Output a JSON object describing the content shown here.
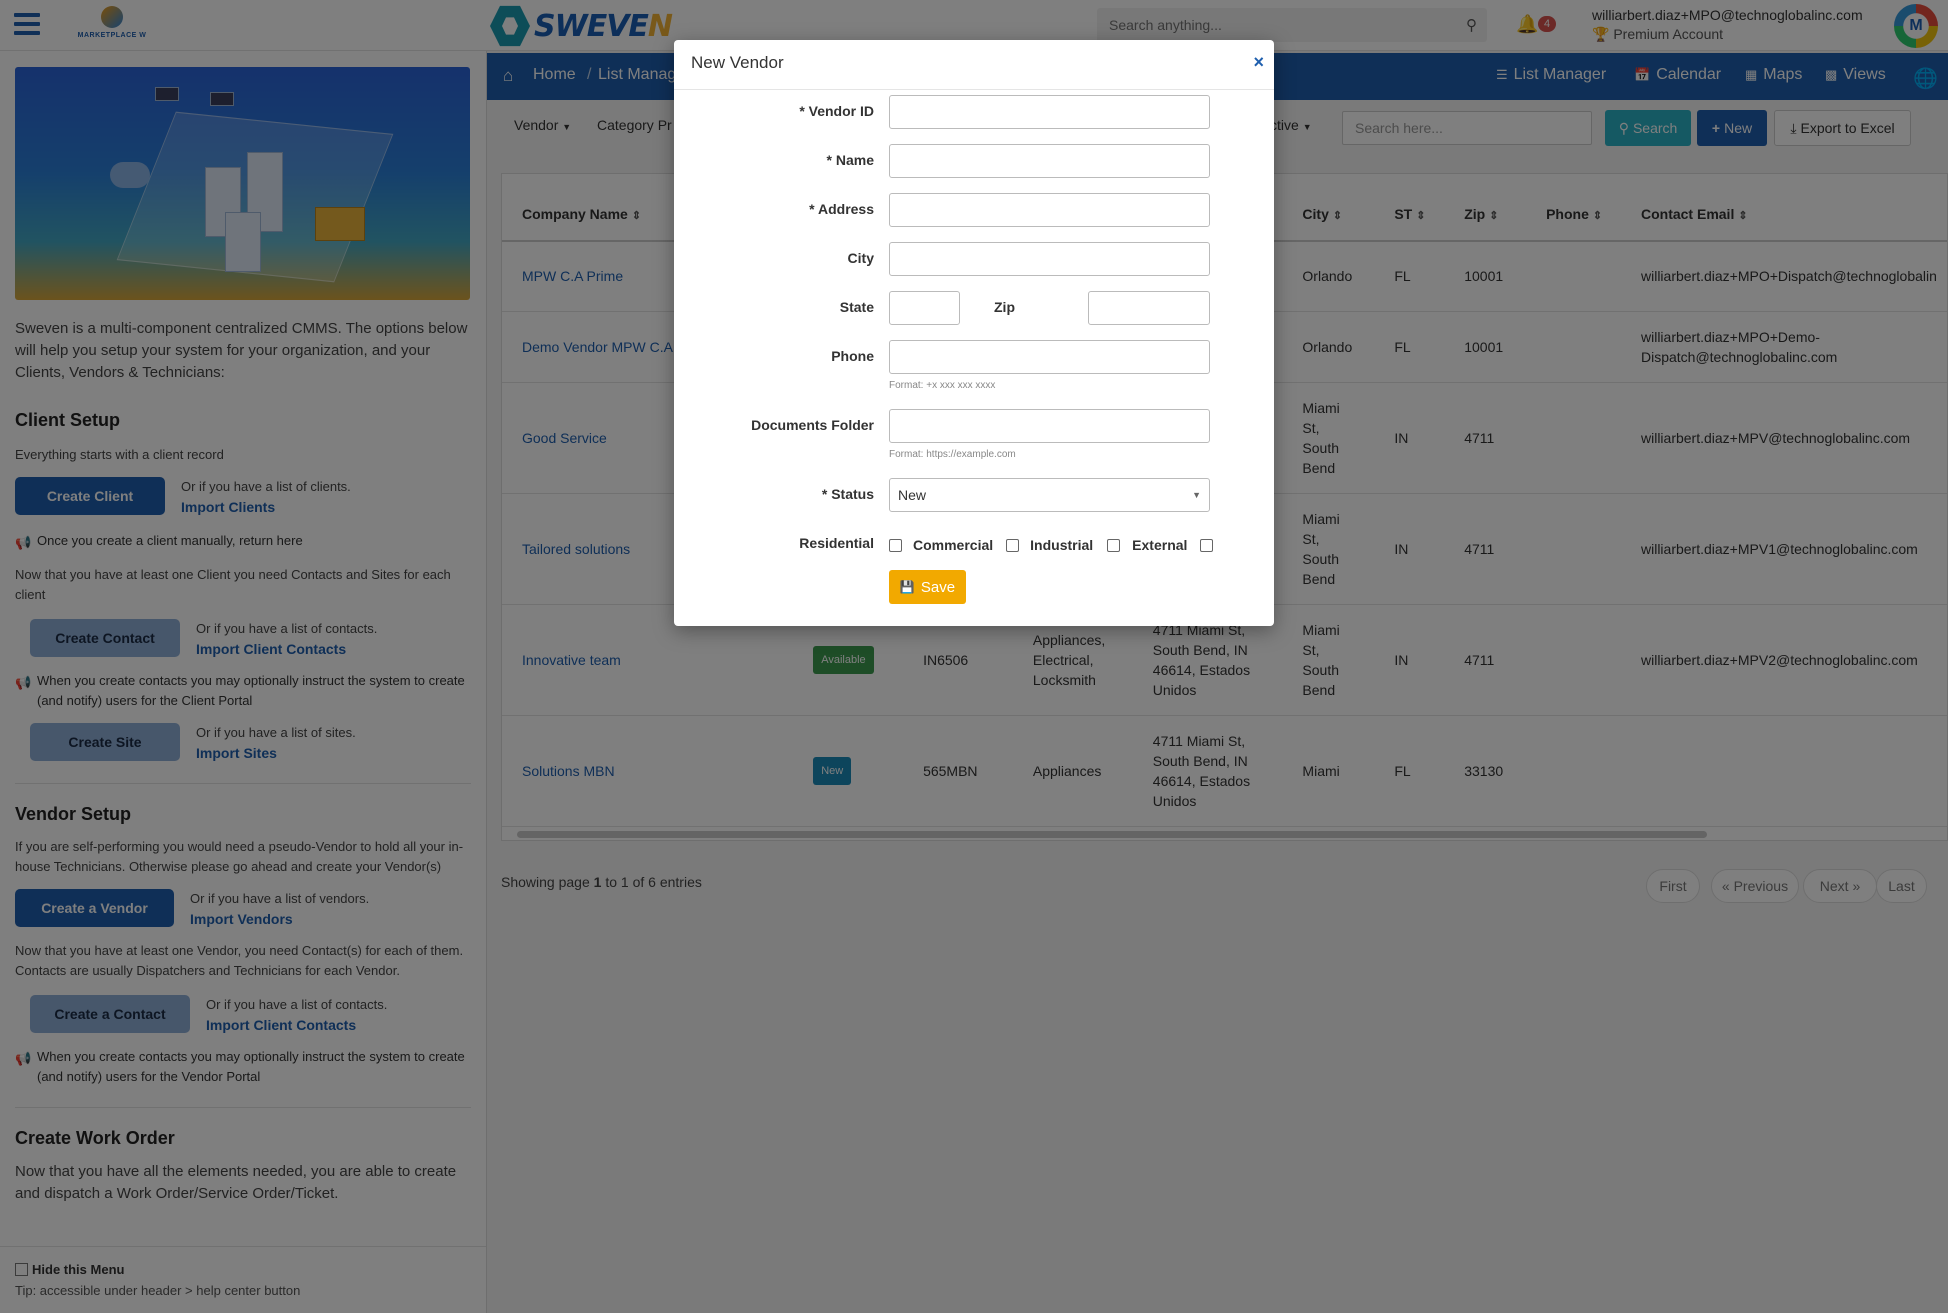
{
  "header": {
    "marketplace_logo_text": "MARKETPLACE W",
    "brand_main": "SWEVE",
    "brand_accent": "N",
    "search_placeholder": "Search anything...",
    "notification_count": "4",
    "user_email": "williarbert.diaz+MPO@technoglobalinc.com",
    "account_type": "Premium Account",
    "avatar_letter": "M"
  },
  "sidebar": {
    "intro": "Sweven is a multi-component centralized CMMS. The options below will help you setup your system for your organization, and your Clients, Vendors & Technicians:",
    "client_setup": {
      "title": "Client Setup",
      "subtitle": "Everything starts with a client record",
      "create_client": "Create Client",
      "or_clients": "Or if you have a list of clients.",
      "import_clients": "Import Clients",
      "note_return": "Once you create a client manually, return here",
      "contacts_text": "Now that you have at least one Client you need Contacts and Sites for each client",
      "create_contact": "Create Contact",
      "or_contacts": "Or if you have a list of contacts.",
      "import_client_contacts": "Import Client Contacts",
      "note_portal": "When you create contacts you may optionally instruct the system to create (and notify) users for the Client Portal",
      "create_site": "Create Site",
      "or_sites": "Or if you have a list of sites.",
      "import_sites": "Import Sites"
    },
    "vendor_setup": {
      "title": "Vendor Setup",
      "text": "If you are self-performing you would need a pseudo-Vendor to hold all your in-house Technicians. Otherwise please go ahead and create your Vendor(s)",
      "create_vendor": "Create a Vendor",
      "or_vendors": "Or if you have a list of vendors.",
      "import_vendors": "Import Vendors",
      "contacts_text": "Now that you have at least one Vendor, you need Contact(s) for each of them. Contacts are usually Dispatchers and Technicians for each Vendor.",
      "create_contact": "Create a Contact",
      "or_contacts": "Or if you have a list of contacts.",
      "import_contacts": "Import Client Contacts",
      "note_portal": "When you create contacts you may optionally instruct the system to create (and notify) users for the Vendor Portal"
    },
    "work_order": {
      "title": "Create Work Order",
      "text": "Now that you have all the elements needed, you are able to create and dispatch a Work Order/Service Order/Ticket."
    },
    "hide_menu": "Hide this Menu",
    "tip": "Tip: accessible under header > help center button"
  },
  "navbar": {
    "home": "Home",
    "slash": "/",
    "list_manager_crumb": "List Manag",
    "list_manager": "List Manager",
    "calendar": "Calendar",
    "maps": "Maps",
    "views": "Views"
  },
  "toolbar": {
    "vendor_dd": "Vendor",
    "category_dd": "Category Pr",
    "active_dd": "ctive",
    "search_placeholder": "Search here...",
    "search_btn": "Search",
    "new_btn": "New",
    "export_btn": "Export to Excel"
  },
  "table": {
    "headers": {
      "company": "Company Name",
      "city": "City",
      "st": "ST",
      "zip": "Zip",
      "phone": "Phone",
      "email": "Contact Email"
    },
    "rows": [
      {
        "company": "MPW C.A Prime",
        "status": "",
        "id": "",
        "category": "",
        "address": "",
        "city": "Orlando",
        "st": "FL",
        "zip": "10001",
        "phone": "",
        "email": "williarbert.diaz+MPO+Dispatch@technoglobalin"
      },
      {
        "company": "Demo Vendor MPW C.A",
        "status": "",
        "id": "",
        "category": "",
        "address": "",
        "city": "Orlando",
        "st": "FL",
        "zip": "10001",
        "phone": "",
        "email": "williarbert.diaz+MPO+Demo-Dispatch@technoglobalinc.com"
      },
      {
        "company": "Good Service",
        "status": "",
        "id": "",
        "category": "",
        "address": "",
        "city": "Miami St, South Bend",
        "st": "IN",
        "zip": "4711",
        "phone": "",
        "email": "williarbert.diaz+MPV@technoglobalinc.com"
      },
      {
        "company": "Tailored solutions",
        "status": "",
        "id": "",
        "category": "",
        "address": "",
        "city": "Miami St, South Bend",
        "st": "IN",
        "zip": "4711",
        "phone": "",
        "email": "williarbert.diaz+MPV1@technoglobalinc.com"
      },
      {
        "company": "Innovative team",
        "status": "Available",
        "id": "IN6506",
        "category": "Appliances, Electrical, Locksmith",
        "address": "4711 Miami St, South Bend, IN 46614, Estados Unidos",
        "city": "Miami St, South Bend",
        "st": "IN",
        "zip": "4711",
        "phone": "",
        "email": "williarbert.diaz+MPV2@technoglobalinc.com"
      },
      {
        "company": "Solutions MBN",
        "status": "New",
        "id": "565MBN",
        "category": "Appliances",
        "address": "4711 Miami St, South Bend, IN 46614, Estados Unidos",
        "city": "Miami",
        "st": "FL",
        "zip": "33130",
        "phone": "",
        "email": ""
      }
    ]
  },
  "paging": {
    "showing_pre": "Showing page ",
    "page": "1",
    "showing_mid": " to ",
    "page_to": "1",
    "showing_post": " of 6 entries",
    "first": "First",
    "previous": "« Previous",
    "next": "Next »",
    "last": "Last"
  },
  "modal": {
    "title": "New Vendor",
    "vendor_id_label": "* Vendor ID",
    "name_label": "* Name",
    "address_label": "* Address",
    "city_label": "City",
    "state_label": "State",
    "zip_label": "Zip",
    "phone_label": "Phone",
    "phone_hint": "Format: +x xxx xxx xxxx",
    "docs_label": "Documents Folder",
    "docs_hint": "Format: https://example.com",
    "status_label": "* Status",
    "status_value": "New",
    "residential_label": "Residential",
    "commercial_label": "Commercial",
    "industrial_label": "Industrial",
    "external_label": "External",
    "save_label": "Save"
  },
  "colors": {
    "primary": "#1f5fae",
    "accent": "#f2a900",
    "available": "#3c9a4f",
    "new_badge": "#1b8ab8",
    "search_btn": "#2bb3c7"
  }
}
